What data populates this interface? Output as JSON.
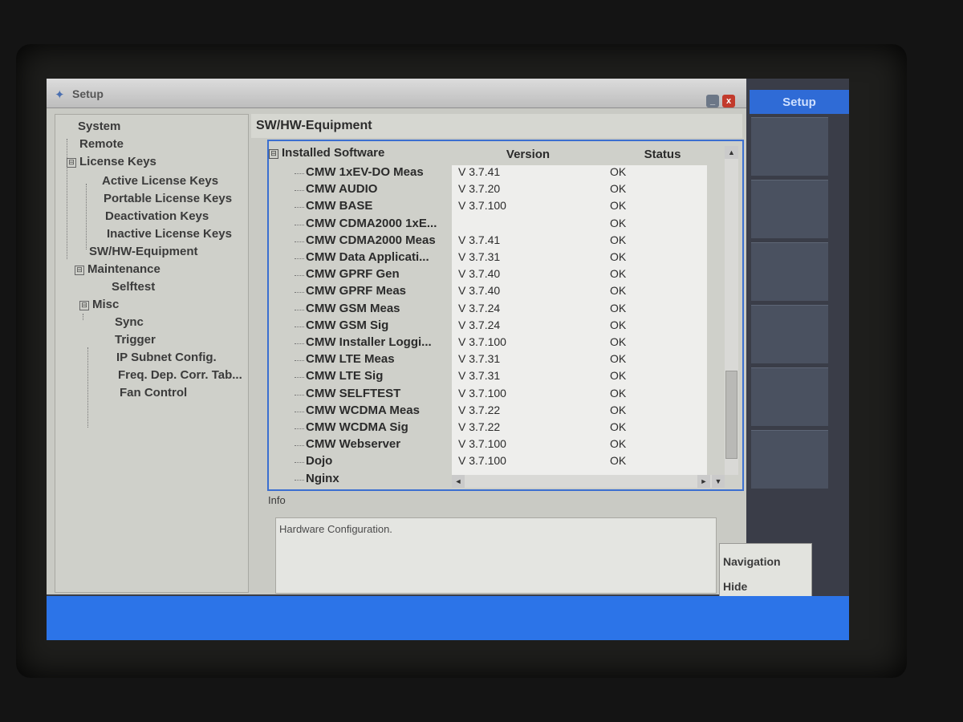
{
  "window": {
    "title": "Setup",
    "minimize_label": "_",
    "close_label": "x"
  },
  "tree": [
    {
      "label": "System",
      "expander": ""
    },
    {
      "label": "Remote",
      "expander": ""
    },
    {
      "label": "License Keys",
      "expander": "⊟"
    },
    {
      "label": "Active License Keys",
      "expander": ""
    },
    {
      "label": "Portable License Keys",
      "expander": ""
    },
    {
      "label": "Deactivation Keys",
      "expander": ""
    },
    {
      "label": "Inactive License Keys",
      "expander": ""
    },
    {
      "label": "SW/HW-Equipment",
      "expander": ""
    },
    {
      "label": "Maintenance",
      "expander": "⊟"
    },
    {
      "label": "Selftest",
      "expander": ""
    },
    {
      "label": "Misc",
      "expander": "⊟"
    },
    {
      "label": "Sync",
      "expander": ""
    },
    {
      "label": "Trigger",
      "expander": ""
    },
    {
      "label": "IP Subnet Config.",
      "expander": ""
    },
    {
      "label": "Freq. Dep. Corr. Tab...",
      "expander": ""
    },
    {
      "label": "Fan Control",
      "expander": ""
    }
  ],
  "main": {
    "section_title": "SW/HW-Equipment",
    "installed_node": {
      "label": "Installed Software",
      "expander": "⊟"
    },
    "columns": {
      "version": "Version",
      "status": "Status"
    },
    "rows": [
      {
        "name": "CMW 1xEV-DO Meas",
        "version": "V 3.7.41",
        "status": "OK"
      },
      {
        "name": "CMW AUDIO",
        "version": "V 3.7.20",
        "status": "OK"
      },
      {
        "name": "CMW BASE",
        "version": "V 3.7.100",
        "status": "OK"
      },
      {
        "name": "CMW CDMA2000 1xE...",
        "version": "",
        "status": "OK"
      },
      {
        "name": "CMW CDMA2000 Meas",
        "version": "V 3.7.41",
        "status": "OK"
      },
      {
        "name": "CMW Data Applicati...",
        "version": "V 3.7.31",
        "status": "OK"
      },
      {
        "name": "CMW GPRF Gen",
        "version": "V 3.7.40",
        "status": "OK"
      },
      {
        "name": "CMW GPRF Meas",
        "version": "V 3.7.40",
        "status": "OK"
      },
      {
        "name": "CMW GSM Meas",
        "version": "V 3.7.24",
        "status": "OK"
      },
      {
        "name": "CMW GSM Sig",
        "version": "V 3.7.24",
        "status": "OK"
      },
      {
        "name": "CMW Installer Loggi...",
        "version": "V 3.7.100",
        "status": "OK"
      },
      {
        "name": "CMW LTE Meas",
        "version": "V 3.7.31",
        "status": "OK"
      },
      {
        "name": "CMW LTE Sig",
        "version": "V 3.7.31",
        "status": "OK"
      },
      {
        "name": "CMW SELFTEST",
        "version": "V 3.7.100",
        "status": "OK"
      },
      {
        "name": "CMW WCDMA Meas",
        "version": "V 3.7.22",
        "status": "OK"
      },
      {
        "name": "CMW WCDMA Sig",
        "version": "V 3.7.22",
        "status": "OK"
      },
      {
        "name": "CMW Webserver",
        "version": "V 3.7.100",
        "status": "OK"
      },
      {
        "name": "Dojo",
        "version": "V 3.7.100",
        "status": "OK"
      },
      {
        "name": "Nginx",
        "version": "",
        "status": ""
      }
    ],
    "scroll": {
      "up_icon": "▲",
      "down_icon": "▼",
      "left_icon": "◄",
      "right_icon": "►"
    },
    "info_label": "Info",
    "info_text": "Hardware Configuration."
  },
  "softkeys": {
    "title": "Setup",
    "navigation_label": "Navigation",
    "hide_label": "Hide"
  },
  "colors": {
    "accent": "#2f6bd6",
    "statusbar": "#2c74e8",
    "selection_border": "#3b6fd0"
  }
}
